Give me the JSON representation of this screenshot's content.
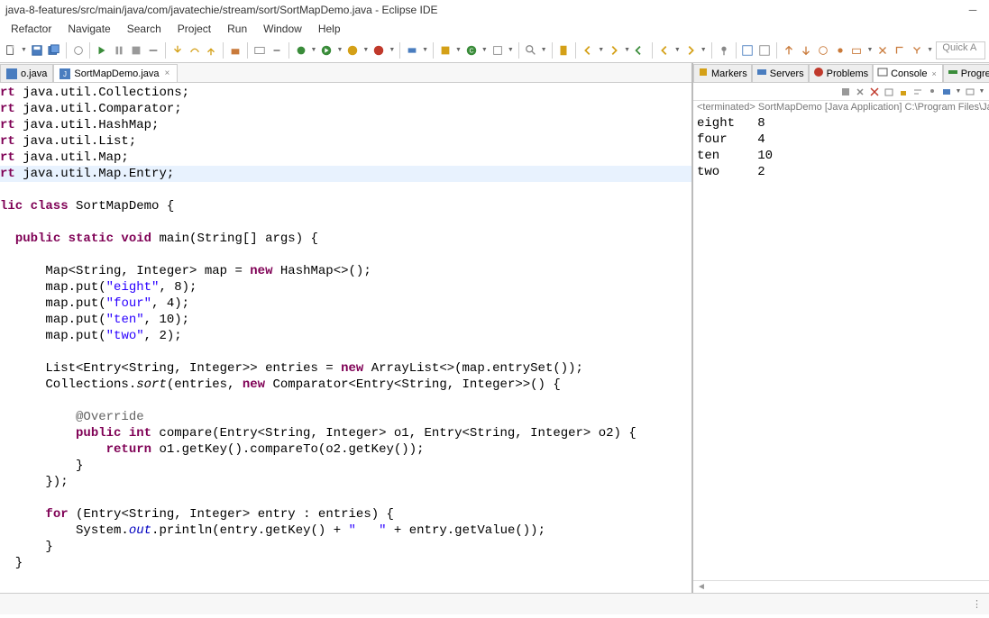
{
  "title": "java-8-features/src/main/java/com/javatechie/stream/sort/SortMapDemo.java - Eclipse IDE",
  "menu": [
    "Refactor",
    "Navigate",
    "Search",
    "Project",
    "Run",
    "Window",
    "Help"
  ],
  "quick_access_placeholder": "Quick A",
  "editor_tabs": [
    {
      "label": "o.java",
      "active": false
    },
    {
      "label": "SortMapDemo.java",
      "active": true
    }
  ],
  "code_lines": [
    {
      "t": "import",
      "rest": " java.util.Collections;"
    },
    {
      "t": "import",
      "rest": " java.util.Comparator;"
    },
    {
      "t": "import",
      "rest": " java.util.HashMap;"
    },
    {
      "t": "import",
      "rest": " java.util.List;"
    },
    {
      "t": "import",
      "rest": " java.util.Map;"
    },
    {
      "t": "import",
      "rest": " java.util.Map.Entry;",
      "hl": true
    }
  ],
  "class_decl": {
    "kw1": "lic class",
    "name": " SortMapDemo {"
  },
  "main_decl": {
    "indent": "  ",
    "kw": "public static void",
    "rest": " main(String[] ",
    "param": "args",
    "end": ") {"
  },
  "body": [
    "      Map<String, Integer> ",
    "      ",
    "      ",
    "      ",
    "      "
  ],
  "map_var": "map",
  "map_init": " = ",
  "new_kw": "new",
  "hashmap": " HashMap<>();",
  "puts": [
    {
      "pre": "map.put(",
      "key": "\"eight\"",
      "val": ", 8);"
    },
    {
      "pre": "map.put(",
      "key": "\"four\"",
      "val": ", 4);"
    },
    {
      "pre": "map.put(",
      "key": "\"ten\"",
      "val": ", 10);"
    },
    {
      "pre": "map.put(",
      "key": "\"two\"",
      "val": ", 2);"
    }
  ],
  "list_line": {
    "pre": "      List<Entry<String, Integer>> ",
    "var": "entries",
    "mid": " = ",
    "new": "new",
    "rest": " ArrayList<>(map.entrySet());"
  },
  "sort_line": {
    "pre": "      Collections.",
    "m": "sort",
    "mid": "(",
    "arg": "entries",
    "mid2": ", ",
    "new": "new",
    "rest": " Comparator<Entry<String, Integer>>() {"
  },
  "override": "          @Override",
  "compare": {
    "pre": "          ",
    "kw": "public int",
    "rest": " compare(Entry<String, Integer> ",
    "p1": "o1",
    "mid": ", Entry<String, Integer> ",
    "p2": "o2",
    "end": ") {"
  },
  "return_line": {
    "pre": "              ",
    "kw": "return",
    "rest": " o1.getKey().compareTo(o2.getKey());"
  },
  "close1": "          }",
  "close2": "      });",
  "for_line": {
    "pre": "      ",
    "kw": "for",
    "rest": " (Entry<String, Integer> ",
    "var": "entry",
    "mid": " : ",
    "var2": "entries",
    "end": ") {"
  },
  "println": {
    "pre": "          System.",
    "out": "out",
    "mid": ".println(",
    "arg": "entry",
    "mid2": ".getKey() + ",
    "str": "\"   \"",
    "mid3": " + ",
    "arg2": "entry",
    "end": ".getValue());"
  },
  "close3": "      }",
  "close4": "  }",
  "view_tabs": [
    {
      "label": "Markers",
      "icon": "markers"
    },
    {
      "label": "Servers",
      "icon": "servers"
    },
    {
      "label": "Problems",
      "icon": "problems"
    },
    {
      "label": "Console",
      "icon": "console",
      "active": true
    },
    {
      "label": "Progress",
      "icon": "progress"
    }
  ],
  "console_status": "<terminated> SortMapDemo [Java Application] C:\\Program Files\\Java\\jdk",
  "console_output": "eight   8\nfour    4\nten     10\ntwo     2"
}
